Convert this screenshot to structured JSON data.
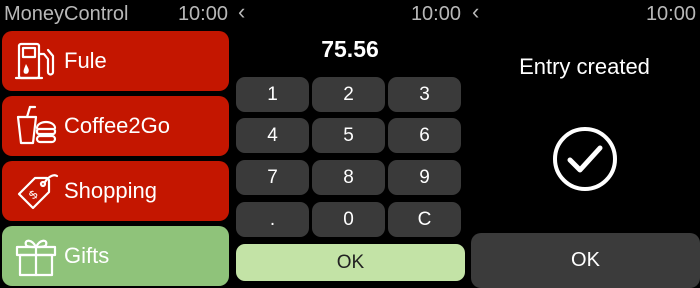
{
  "screen1": {
    "app_title": "MoneyControl",
    "time": "10:00",
    "categories": [
      {
        "label": "Fule",
        "icon": "fuel-pump-icon",
        "color": "#c41600"
      },
      {
        "label": "Coffee2Go",
        "icon": "coffee-cup-icon",
        "color": "#c41600"
      },
      {
        "label": "Shopping",
        "icon": "price-tag-icon",
        "color": "#c41600"
      },
      {
        "label": "Gifts",
        "icon": "gift-box-icon",
        "color": "#8fc37a"
      }
    ]
  },
  "screen2": {
    "back": "‹",
    "time": "10:00",
    "amount": "75.56",
    "keys": [
      "1",
      "2",
      "3",
      "4",
      "5",
      "6",
      "7",
      "8",
      "9",
      ".",
      "0",
      "C"
    ],
    "ok_label": "OK",
    "ok_color": "#c3e3a6"
  },
  "screen3": {
    "back": "‹",
    "time": "10:00",
    "message": "Entry created",
    "icon": "checkmark-circle-icon",
    "ok_label": "OK"
  }
}
